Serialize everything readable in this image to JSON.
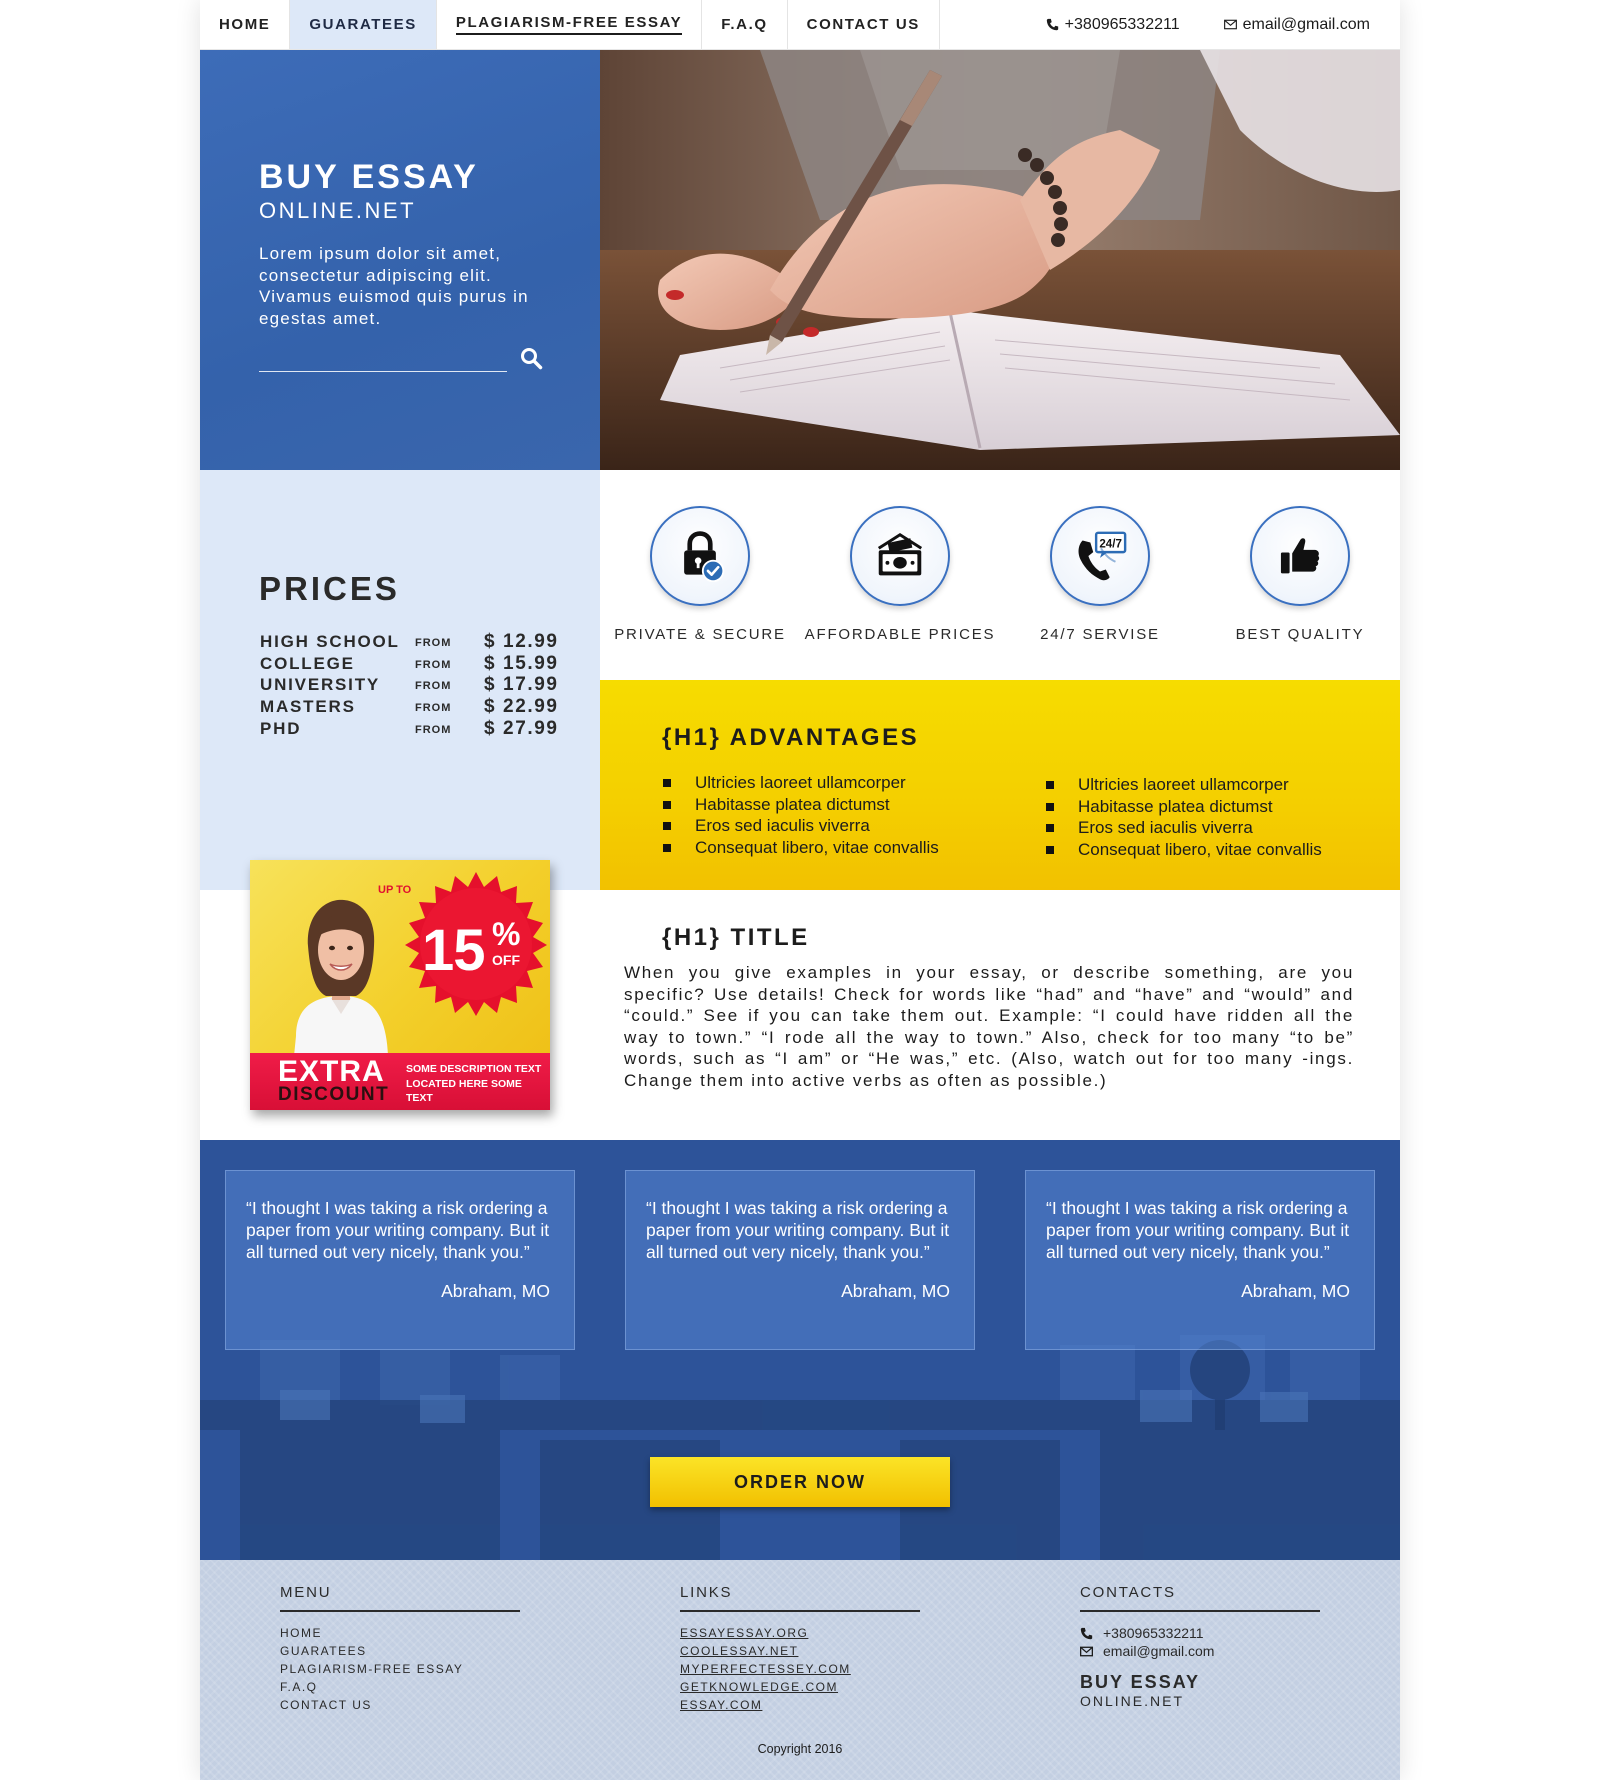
{
  "nav": {
    "items": [
      {
        "label": "HOME"
      },
      {
        "label": "GUARATEES"
      },
      {
        "label": "PLAGIARISM-FREE ESSAY"
      },
      {
        "label": "F.A.Q"
      },
      {
        "label": "CONTACT US"
      }
    ],
    "active_index": 1,
    "phone": "+380965332211",
    "email": "email@gmail.com",
    "phone_icon": "phone-icon",
    "email_icon": "envelope-icon"
  },
  "hero": {
    "brand_line1": "BUY ESSAY",
    "brand_line2": "ONLINE.NET",
    "description": "Lorem ipsum dolor sit amet, consectetur adipiscing elit. Vivamus euismod quis purus in egestas amet.",
    "search_placeholder": "",
    "search_icon": "search-icon"
  },
  "prices": {
    "title": "PRICES",
    "rows": [
      {
        "level": "HIGH SCHOOL",
        "from": "FROM",
        "amount": "$ 12.99"
      },
      {
        "level": "COLLEGE",
        "from": "FROM",
        "amount": "$ 15.99"
      },
      {
        "level": "UNIVERSITY",
        "from": "FROM",
        "amount": "$ 17.99"
      },
      {
        "level": "MASTERS",
        "from": "FROM",
        "amount": "$ 22.99"
      },
      {
        "level": "PHD",
        "from": "FROM",
        "amount": "$ 27.99"
      }
    ]
  },
  "features": [
    {
      "label": "PRIVATE & SECURE",
      "icon": "lock-check-icon"
    },
    {
      "label": "AFFORDABLE PRICES",
      "icon": "money-icon"
    },
    {
      "label": "24/7 SERVISE",
      "icon": "phone-247-icon",
      "badge": "24/7"
    },
    {
      "label": "BEST QUALITY",
      "icon": "thumbs-up-icon"
    }
  ],
  "advantages": {
    "title": "{H1} ADVANTAGES",
    "list_left": [
      "Ultricies laoreet ullamcorper",
      "Habitasse platea dictumst",
      "Eros sed iaculis viverra",
      "Consequat libero, vitae convallis"
    ],
    "list_right": [
      "Ultricies laoreet ullamcorper",
      "Habitasse platea dictumst",
      "Eros sed iaculis viverra",
      "Consequat libero, vitae convallis"
    ]
  },
  "promo": {
    "up_to": "UP TO",
    "percent": "15",
    "percent_sign": "%",
    "off": "OFF",
    "extra": "EXTRA",
    "discount": "DISCOUNT",
    "description": "SOME DESCRIPTION TEXT LOCATED HERE SOME TEXT"
  },
  "title_section": {
    "title": "{H1} TITLE",
    "body": "When you give examples in your essay, or describe something, are you specific? Use details! Check for words like “had” and “have” and “would” and “could.” See if you can take them out. Example: “I could have ridden all the way to town.” “I rode all the way to town.” Also, check for too many “to be” words, such as “I am” or “He was,” etc. (Also, watch out for too many -ings. Change them into active verbs as often as possible.)"
  },
  "testimonials": [
    {
      "quote": "“I thought I was taking a risk ordering a paper from your writing company. But it all turned out very nicely, thank you.”",
      "author": "Abraham, MO"
    },
    {
      "quote": "“I thought I was taking a risk ordering a paper from your writing company. But it all turned out very nicely, thank you.”",
      "author": "Abraham, MO"
    },
    {
      "quote": "“I thought I was taking a risk ordering a paper from your writing company. But it all turned out very nicely, thank you.”",
      "author": "Abraham, MO"
    }
  ],
  "order_button": "ORDER NOW",
  "footer": {
    "menu_title": "MENU",
    "menu_items": [
      "HOME",
      "GUARATEES",
      "PLAGIARISM-FREE ESSAY",
      "F.A.Q",
      "CONTACT US"
    ],
    "links_title": "LINKS",
    "links": [
      "ESSAYESSAY.ORG",
      "COOLESSAY.NET",
      "MYPERFECTESSEY.COM",
      "GETKNOWLEDGE.COM",
      "ESSAY.COM"
    ],
    "contacts_title": "CONTACTS",
    "phone": "+380965332211",
    "email": "email@gmail.com",
    "brand_line1": "BUY ESSAY",
    "brand_line2": "ONLINE.NET",
    "copyright": "Copyright 2016"
  },
  "colors": {
    "brand_blue": "#3462ab",
    "light_blue": "#dde8f8",
    "yellow": "#f4d000",
    "promo_red": "#e01030",
    "footer_bg": "#c3cfe2"
  }
}
